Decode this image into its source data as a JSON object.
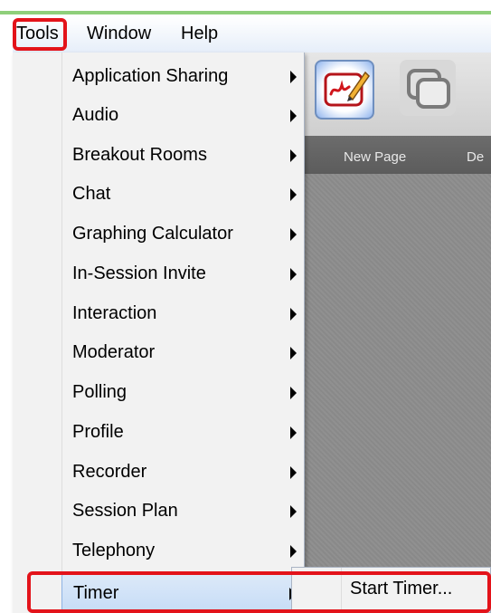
{
  "menubar": {
    "items": [
      {
        "label": "Tools"
      },
      {
        "label": "Window"
      },
      {
        "label": "Help"
      }
    ]
  },
  "tools_menu": {
    "items": [
      {
        "label": "Application Sharing",
        "has_submenu": true
      },
      {
        "label": "Audio",
        "has_submenu": true
      },
      {
        "label": "Breakout Rooms",
        "has_submenu": true
      },
      {
        "label": "Chat",
        "has_submenu": true
      },
      {
        "label": "Graphing Calculator",
        "has_submenu": true
      },
      {
        "label": "In-Session Invite",
        "has_submenu": true
      },
      {
        "label": "Interaction",
        "has_submenu": true
      },
      {
        "label": "Moderator",
        "has_submenu": true
      },
      {
        "label": "Polling",
        "has_submenu": true
      },
      {
        "label": "Profile",
        "has_submenu": true
      },
      {
        "label": "Recorder",
        "has_submenu": true
      },
      {
        "label": "Session Plan",
        "has_submenu": true
      },
      {
        "label": "Telephony",
        "has_submenu": true
      },
      {
        "label": "Timer",
        "has_submenu": true,
        "selected": true
      }
    ]
  },
  "timer_submenu": {
    "items": [
      {
        "label": "Start Timer..."
      }
    ]
  },
  "whiteboard_toolbar": {
    "buttons": [
      {
        "label": "New Page",
        "icon": "new-page-icon"
      },
      {
        "label": "De",
        "icon": "duplicate-page-icon"
      }
    ]
  },
  "colors": {
    "highlight_red": "#e3131a",
    "menu_background": "#f2f2f2",
    "canvas_gray": "#8d8d8d"
  }
}
